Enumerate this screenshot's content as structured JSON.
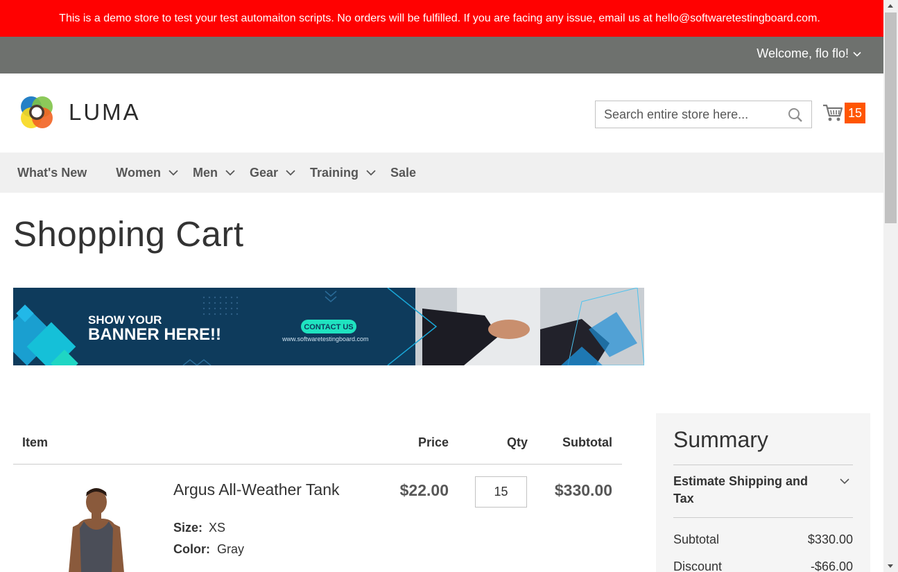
{
  "notice": {
    "text": "This is a demo store to test your test automaiton scripts. No orders will be fulfilled. If you are facing any issue, email us at hello@softwaretestingboard.com."
  },
  "top_bar": {
    "welcome": "Welcome, flo flo!"
  },
  "header": {
    "logo_text": "LUMA",
    "search_placeholder": "Search entire store here...",
    "cart_count": "15"
  },
  "nav": {
    "items": [
      {
        "label": "What's New"
      },
      {
        "label": "Women"
      },
      {
        "label": "Men"
      },
      {
        "label": "Gear"
      },
      {
        "label": "Training"
      },
      {
        "label": "Sale"
      }
    ]
  },
  "page": {
    "title": "Shopping Cart"
  },
  "banner": {
    "line1": "SHOW YOUR",
    "line2": "BANNER HERE!!",
    "button": "CONTACT US",
    "url": "www.softwaretestingboard.com"
  },
  "cart": {
    "headers": {
      "item": "Item",
      "price": "Price",
      "qty": "Qty",
      "subtotal": "Subtotal"
    },
    "items": [
      {
        "name": "Argus All-Weather Tank",
        "price": "$22.00",
        "qty": "15",
        "subtotal": "$330.00",
        "options": [
          {
            "label": "Size:",
            "value": "XS"
          },
          {
            "label": "Color:",
            "value": "Gray"
          }
        ]
      }
    ]
  },
  "summary": {
    "title": "Summary",
    "shipping_label": "Estimate Shipping and Tax",
    "rows": [
      {
        "label": "Subtotal",
        "value": "$330.00"
      },
      {
        "label": "Discount",
        "value": "-$66.00"
      }
    ]
  },
  "colors": {
    "notice_bg": "#ff0101",
    "top_bar_bg": "#6e716e",
    "cart_badge": "#ff5501",
    "nav_bg": "#f0f0f0",
    "summary_bg": "#f5f5f5"
  }
}
